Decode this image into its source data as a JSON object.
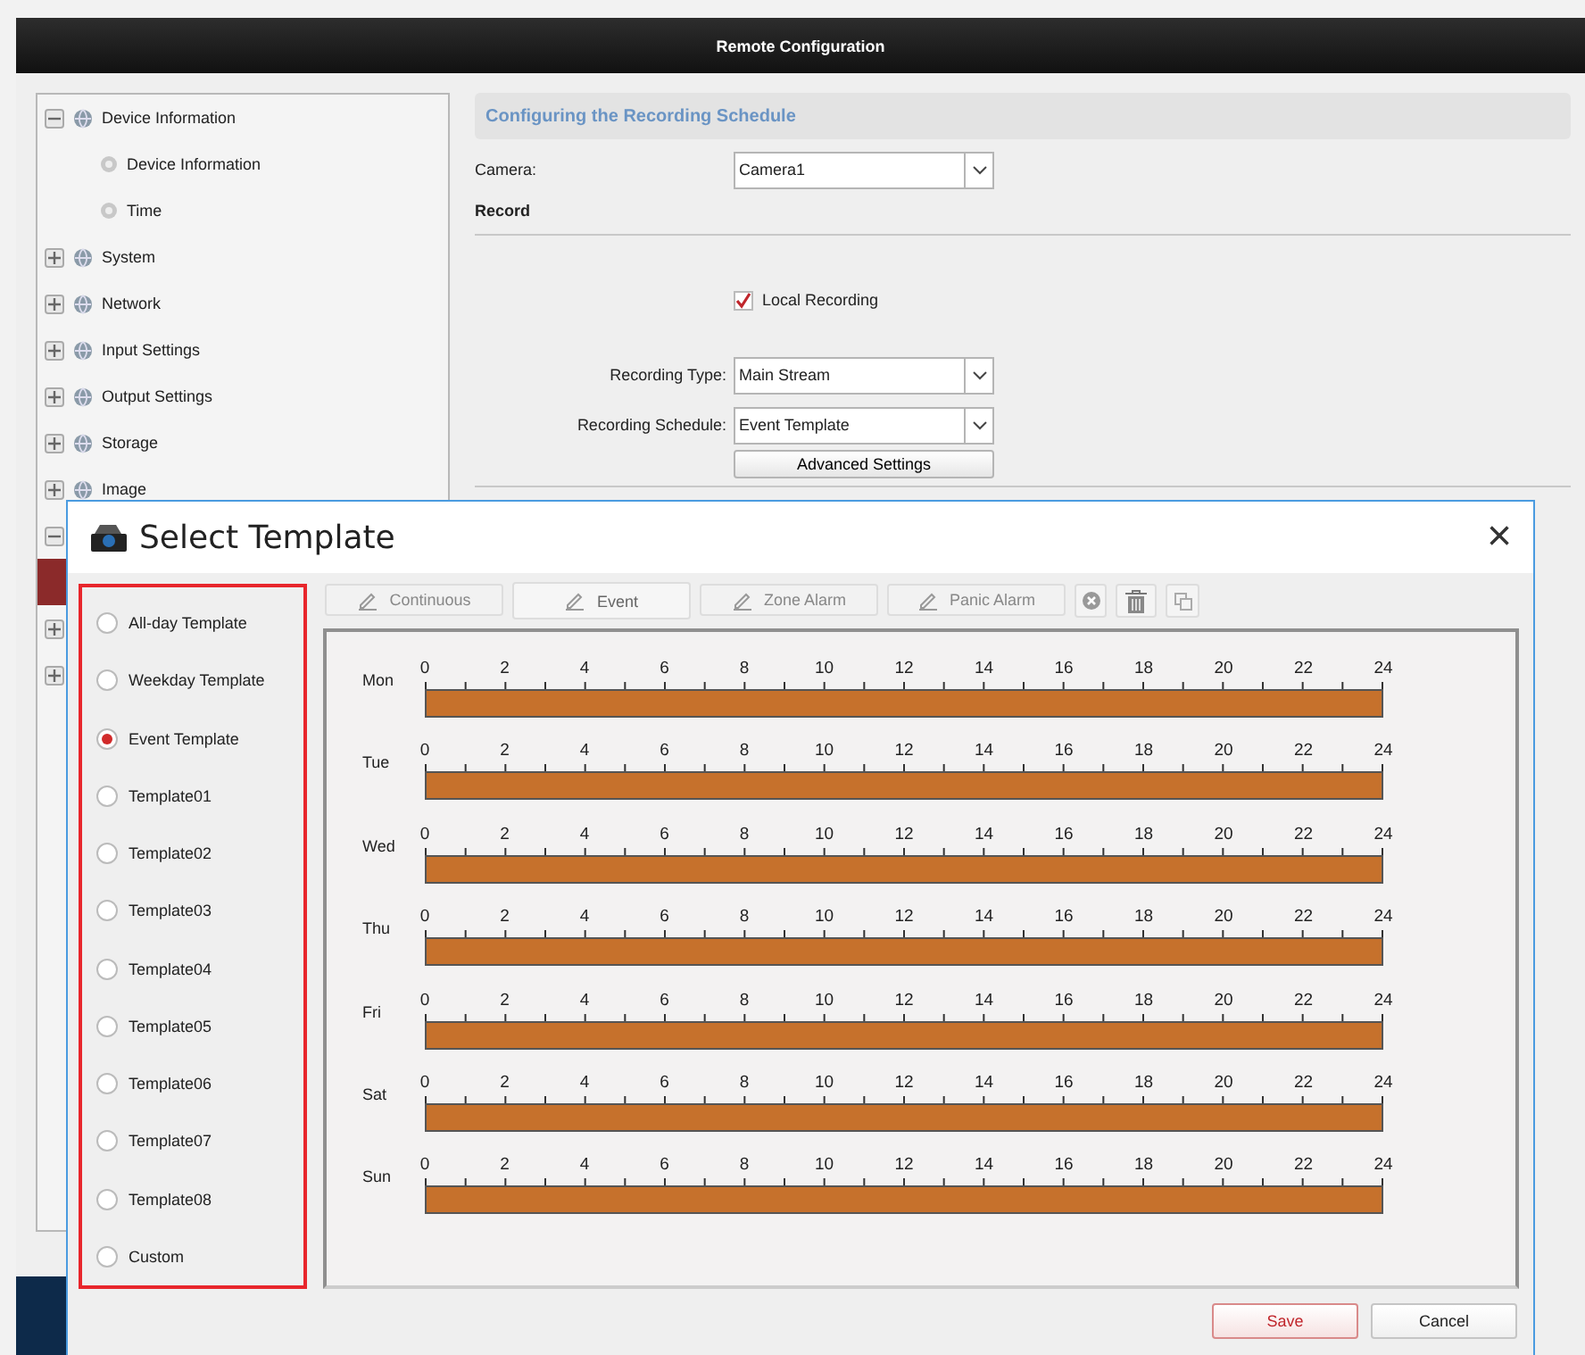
{
  "window": {
    "title": "Remote Configuration"
  },
  "sidebar": {
    "items": [
      {
        "label": "Device Information",
        "expanded": true,
        "children": [
          {
            "label": "Device Information"
          },
          {
            "label": "Time"
          }
        ]
      },
      {
        "label": "System",
        "expanded": false
      },
      {
        "label": "Network",
        "expanded": false
      },
      {
        "label": "Input Settings",
        "expanded": false
      },
      {
        "label": "Output Settings",
        "expanded": false
      },
      {
        "label": "Storage",
        "expanded": false
      },
      {
        "label": "Image",
        "expanded": false
      },
      {
        "expanded": true,
        "children": [
          {
            "selected": true
          }
        ]
      },
      {
        "expanded": false
      },
      {
        "expanded": false
      }
    ]
  },
  "panel": {
    "title": "Configuring the Recording Schedule",
    "camera": {
      "label": "Camera:",
      "value": "Camera1"
    },
    "section": "Record",
    "local_recording": {
      "label": "Local Recording",
      "checked": true
    },
    "recording_type": {
      "label": "Recording Type:",
      "value": "Main Stream"
    },
    "recording_schedule": {
      "label": "Recording Schedule:",
      "value": "Event Template"
    },
    "advanced_button": "Advanced Settings"
  },
  "dialog": {
    "title": "Select Template",
    "close": "×",
    "templates": [
      {
        "label": "All-day Template",
        "selected": false
      },
      {
        "label": "Weekday Template",
        "selected": false
      },
      {
        "label": "Event Template",
        "selected": true
      },
      {
        "label": "Template01",
        "selected": false
      },
      {
        "label": "Template02",
        "selected": false
      },
      {
        "label": "Template03",
        "selected": false
      },
      {
        "label": "Template04",
        "selected": false
      },
      {
        "label": "Template05",
        "selected": false
      },
      {
        "label": "Template06",
        "selected": false
      },
      {
        "label": "Template07",
        "selected": false
      },
      {
        "label": "Template08",
        "selected": false
      },
      {
        "label": "Custom",
        "selected": false
      }
    ],
    "tools": [
      {
        "kind": "text",
        "label": "Continuous",
        "selected": false
      },
      {
        "kind": "text",
        "label": "Event",
        "selected": true
      },
      {
        "kind": "text",
        "label": "Zone Alarm",
        "selected": false
      },
      {
        "kind": "text",
        "label": "Panic Alarm",
        "selected": false
      },
      {
        "kind": "clear"
      },
      {
        "kind": "delete"
      },
      {
        "kind": "copy"
      }
    ],
    "days": [
      {
        "label": "Mon",
        "level": 1,
        "hours": [
          "0",
          "2",
          "4",
          "6",
          "8",
          "10",
          "12",
          "14",
          "16",
          "18",
          "20",
          "22",
          "24"
        ]
      },
      {
        "label": "Tue",
        "level": 1,
        "hours": [
          "0",
          "2",
          "4",
          "6",
          "8",
          "10",
          "12",
          "14",
          "16",
          "18",
          "20",
          "22",
          "24"
        ]
      },
      {
        "label": "Wed",
        "level": 1,
        "hours": [
          "0",
          "2",
          "4",
          "6",
          "8",
          "10",
          "12",
          "14",
          "16",
          "18",
          "20",
          "22",
          "24"
        ]
      },
      {
        "label": "Thu",
        "level": 1,
        "hours": [
          "0",
          "2",
          "4",
          "6",
          "8",
          "10",
          "12",
          "14",
          "16",
          "18",
          "20",
          "22",
          "24"
        ]
      },
      {
        "label": "Fri",
        "level": 1,
        "hours": [
          "0",
          "2",
          "4",
          "6",
          "8",
          "10",
          "12",
          "14",
          "16",
          "18",
          "20",
          "22",
          "24"
        ]
      },
      {
        "label": "Sat",
        "level": 1,
        "hours": [
          "0",
          "2",
          "4",
          "6",
          "8",
          "10",
          "12",
          "14",
          "16",
          "18",
          "20",
          "22",
          "24"
        ]
      },
      {
        "label": "Sun",
        "level": 1,
        "hours": [
          "0",
          "2",
          "4",
          "6",
          "8",
          "10",
          "12",
          "14",
          "16",
          "18",
          "20",
          "22",
          "24"
        ]
      }
    ],
    "buttons": [
      {
        "kind": "primary",
        "label": "Save"
      },
      {
        "kind": "normal",
        "label": "Cancel"
      }
    ]
  }
}
